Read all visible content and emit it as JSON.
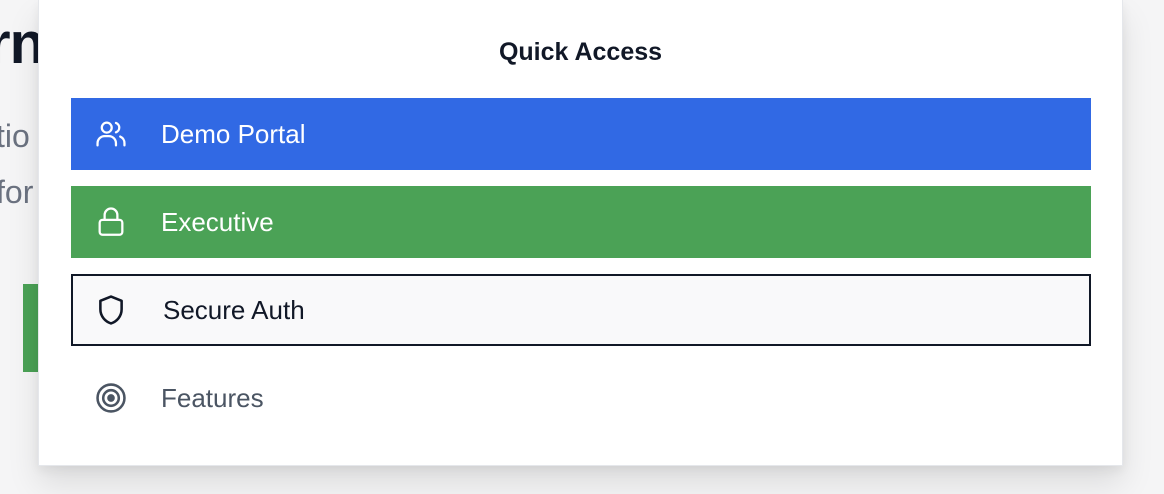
{
  "background": {
    "heading_fragment": "rn",
    "line1_fragment": "tio",
    "line2_fragment": "for"
  },
  "popover": {
    "title": "Quick Access",
    "items": [
      {
        "label": "Demo Portal",
        "icon": "users-icon",
        "color": "#3169e4",
        "style": "filled"
      },
      {
        "label": "Executive",
        "icon": "lock-icon",
        "color": "#4ba256",
        "style": "filled"
      },
      {
        "label": "Secure Auth",
        "icon": "shield-icon",
        "color": "#111827",
        "style": "outlined-focused"
      },
      {
        "label": "Features",
        "icon": "target-icon",
        "color": "#4b5563",
        "style": "plain"
      }
    ]
  }
}
